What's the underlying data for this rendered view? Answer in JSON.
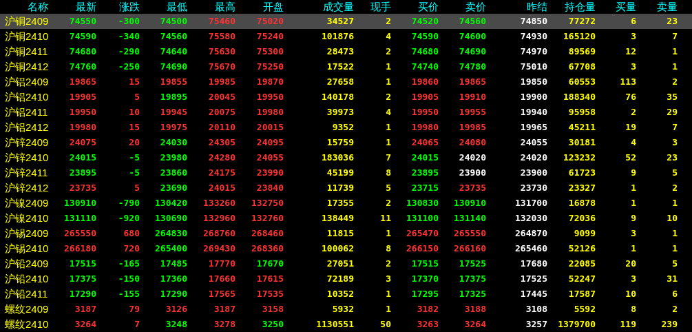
{
  "table": {
    "columns": [
      "名称",
      "最新",
      "涨跌",
      "最低",
      "最高",
      "开盘",
      "成交量",
      "现手",
      "买价",
      "卖价",
      "昨结",
      "持仓量",
      "买量",
      "卖量"
    ],
    "rows": [
      {
        "selected": true,
        "cells": [
          "沪铜2409",
          "74550",
          "-300",
          "74500",
          "75460",
          "75020",
          "34527",
          "2",
          "74520",
          "74560",
          "74850",
          "77272",
          "6",
          "23"
        ]
      },
      {
        "selected": false,
        "cells": [
          "沪铜2410",
          "74590",
          "-340",
          "74560",
          "75580",
          "75240",
          "101876",
          "4",
          "74590",
          "74600",
          "74930",
          "165120",
          "3",
          "7"
        ]
      },
      {
        "selected": false,
        "cells": [
          "沪铜2411",
          "74680",
          "-290",
          "74640",
          "75630",
          "75300",
          "28473",
          "2",
          "74680",
          "74690",
          "74970",
          "89569",
          "12",
          "1"
        ]
      },
      {
        "selected": false,
        "cells": [
          "沪铜2412",
          "74760",
          "-250",
          "74690",
          "75670",
          "75250",
          "17522",
          "1",
          "74740",
          "74780",
          "75010",
          "67708",
          "3",
          "1"
        ]
      },
      {
        "selected": false,
        "cells": [
          "沪铝2409",
          "19865",
          "15",
          "19855",
          "19985",
          "19870",
          "27658",
          "1",
          "19860",
          "19865",
          "19850",
          "60553",
          "113",
          "2"
        ]
      },
      {
        "selected": false,
        "cells": [
          "沪铝2410",
          "19905",
          "5",
          "19895",
          "20045",
          "19950",
          "140178",
          "2",
          "19905",
          "19910",
          "19900",
          "188340",
          "76",
          "35"
        ]
      },
      {
        "selected": false,
        "cells": [
          "沪铝2411",
          "19950",
          "10",
          "19945",
          "20075",
          "19980",
          "39973",
          "4",
          "19950",
          "19955",
          "19940",
          "95958",
          "2",
          "29"
        ]
      },
      {
        "selected": false,
        "cells": [
          "沪铝2412",
          "19980",
          "15",
          "19975",
          "20110",
          "20015",
          "9352",
          "1",
          "19980",
          "19985",
          "19965",
          "45211",
          "19",
          "7"
        ]
      },
      {
        "selected": false,
        "cells": [
          "沪锌2409",
          "24075",
          "20",
          "24030",
          "24305",
          "24095",
          "15759",
          "1",
          "24065",
          "24080",
          "24055",
          "30181",
          "4",
          "3"
        ]
      },
      {
        "selected": false,
        "cells": [
          "沪锌2410",
          "24015",
          "-5",
          "23980",
          "24280",
          "24055",
          "183036",
          "7",
          "24015",
          "24020",
          "24020",
          "123232",
          "52",
          "23"
        ]
      },
      {
        "selected": false,
        "cells": [
          "沪锌2411",
          "23895",
          "-5",
          "23860",
          "24175",
          "23990",
          "45199",
          "8",
          "23895",
          "23900",
          "23900",
          "61723",
          "9",
          "5"
        ]
      },
      {
        "selected": false,
        "cells": [
          "沪锌2412",
          "23735",
          "5",
          "23690",
          "24015",
          "23840",
          "11739",
          "5",
          "23715",
          "23735",
          "23730",
          "23327",
          "1",
          "2"
        ]
      },
      {
        "selected": false,
        "cells": [
          "沪镍2409",
          "130910",
          "-790",
          "130420",
          "133260",
          "132750",
          "17355",
          "2",
          "130830",
          "130910",
          "131700",
          "16878",
          "1",
          "1"
        ]
      },
      {
        "selected": false,
        "cells": [
          "沪镍2410",
          "131110",
          "-920",
          "130690",
          "132960",
          "132760",
          "138449",
          "11",
          "131100",
          "131140",
          "132030",
          "72036",
          "9",
          "10"
        ]
      },
      {
        "selected": false,
        "cells": [
          "沪锡2409",
          "265550",
          "680",
          "264830",
          "268760",
          "268460",
          "11815",
          "1",
          "265470",
          "265550",
          "264870",
          "9099",
          "3",
          "1"
        ]
      },
      {
        "selected": false,
        "cells": [
          "沪锡2410",
          "266180",
          "720",
          "265400",
          "269430",
          "268360",
          "100062",
          "8",
          "266150",
          "266160",
          "265460",
          "52126",
          "1",
          "1"
        ]
      },
      {
        "selected": false,
        "cells": [
          "沪铅2409",
          "17515",
          "-165",
          "17485",
          "17770",
          "17670",
          "27051",
          "2",
          "17515",
          "17525",
          "17680",
          "22085",
          "20",
          "5"
        ]
      },
      {
        "selected": false,
        "cells": [
          "沪铅2410",
          "17375",
          "-150",
          "17360",
          "17660",
          "17615",
          "72189",
          "3",
          "17370",
          "17375",
          "17525",
          "52247",
          "3",
          "31"
        ]
      },
      {
        "selected": false,
        "cells": [
          "沪铅2411",
          "17290",
          "-155",
          "17290",
          "17565",
          "17535",
          "10352",
          "1",
          "17295",
          "17325",
          "17445",
          "17587",
          "10",
          "6"
        ]
      },
      {
        "selected": false,
        "cells": [
          "螺纹2409",
          "3187",
          "79",
          "3126",
          "3187",
          "3158",
          "5932",
          "1",
          "3182",
          "3188",
          "3108",
          "5592",
          "8",
          "2"
        ]
      },
      {
        "selected": false,
        "cells": [
          "螺纹2410",
          "3264",
          "7",
          "3248",
          "3278",
          "3250",
          "1130551",
          "50",
          "3263",
          "3264",
          "3257",
          "1379700",
          "119",
          "239"
        ]
      }
    ]
  }
}
